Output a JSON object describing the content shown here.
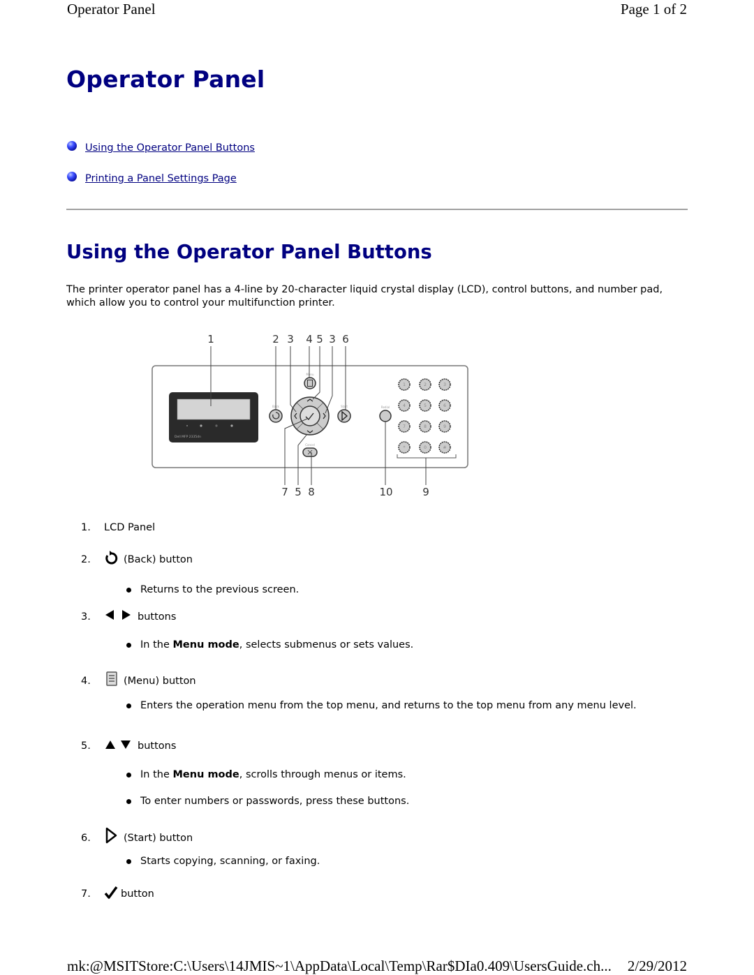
{
  "header": {
    "title": "Operator Panel",
    "page_indicator": "Page 1 of 2"
  },
  "page_title": "Operator Panel",
  "toc": [
    {
      "label": "Using the Operator Panel Buttons"
    },
    {
      "label": "Printing a Panel Settings Page"
    }
  ],
  "section": {
    "title": "Using the Operator Panel Buttons",
    "intro": "The printer operator panel has a 4-line by 20-character liquid crystal display (LCD), control buttons, and number pad, which allow you to control your multifunction printer."
  },
  "diagram": {
    "callouts_top": [
      "1",
      "2",
      "3",
      "4",
      "5",
      "3",
      "6"
    ],
    "callouts_bottom": [
      "7",
      "5",
      "8",
      "10",
      "9"
    ],
    "model_label": "Dell MFP 2335dn",
    "button_labels": {
      "back": "Back",
      "menu": "Menu",
      "start": "Start",
      "cancel": "Cancel",
      "redial": "Redial"
    },
    "keypad": [
      "1",
      "2",
      "3",
      "4",
      "5",
      "6",
      "7",
      "8",
      "9",
      "*",
      "0",
      "#"
    ]
  },
  "items": [
    {
      "num": "1.",
      "icon": "",
      "label": "LCD Panel",
      "bullets": []
    },
    {
      "num": "2.",
      "icon": "back-arrow-icon",
      "label": "(Back) button",
      "bullets": [
        {
          "pre": "Returns to the previous screen.",
          "bold": "",
          "post": ""
        }
      ]
    },
    {
      "num": "3.",
      "icon": "left-right-arrows-icon",
      "label": "buttons",
      "bullets": [
        {
          "pre": "In the ",
          "bold": "Menu mode",
          "post": ", selects submenus or sets values."
        }
      ]
    },
    {
      "num": "4.",
      "icon": "menu-icon",
      "label": "(Menu) button",
      "bullets": [
        {
          "pre": "Enters the operation menu from the top menu, and returns to the top menu from any menu level.",
          "bold": "",
          "post": ""
        }
      ]
    },
    {
      "num": "5.",
      "icon": "up-down-arrows-icon",
      "label": "buttons",
      "bullets": [
        {
          "pre": "In the ",
          "bold": "Menu mode",
          "post": ", scrolls through menus or items."
        },
        {
          "pre": "To enter numbers or passwords, press these buttons.",
          "bold": "",
          "post": ""
        }
      ]
    },
    {
      "num": "6.",
      "icon": "start-icon",
      "label": "(Start) button",
      "bullets": [
        {
          "pre": "Starts copying, scanning, or faxing.",
          "bold": "",
          "post": ""
        }
      ]
    },
    {
      "num": "7.",
      "icon": "checkmark-icon",
      "label": "button",
      "bullets": []
    }
  ],
  "footer": {
    "path": "mk:@MSITStore:C:\\Users\\14JMIS~1\\AppData\\Local\\Temp\\Rar$DIa0.409\\UsersGuide.ch...",
    "date": "2/29/2012"
  },
  "colors": {
    "heading": "#000080",
    "link": "#000080",
    "rule": "#a0a0a0"
  }
}
